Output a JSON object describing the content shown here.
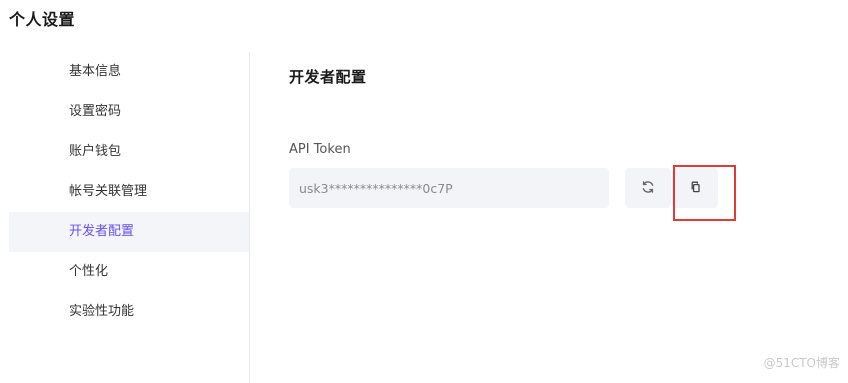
{
  "page": {
    "title": "个人设置"
  },
  "sidebar": {
    "items": [
      {
        "label": "基本信息",
        "active": false
      },
      {
        "label": "设置密码",
        "active": false
      },
      {
        "label": "账户钱包",
        "active": false
      },
      {
        "label": "帐号关联管理",
        "active": false
      },
      {
        "label": "开发者配置",
        "active": true
      },
      {
        "label": "个性化",
        "active": false
      },
      {
        "label": "实验性功能",
        "active": false
      }
    ]
  },
  "main": {
    "section_title": "开发者配置",
    "token_label": "API Token",
    "token_value": "usk3***************0c7P",
    "refresh_icon": "refresh-icon",
    "copy_icon": "copy-icon"
  },
  "colors": {
    "accent": "#6b4ef6",
    "active_bg": "#f4f5f9",
    "input_bg": "#f3f4f7",
    "highlight": "#e53935"
  },
  "watermark": "@51CTO博客"
}
